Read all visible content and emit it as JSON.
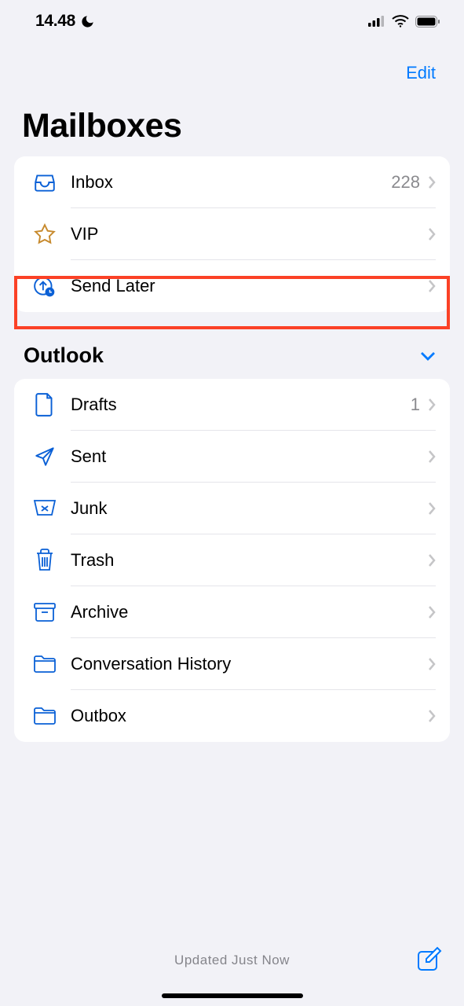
{
  "status_bar": {
    "time": "14.48"
  },
  "nav": {
    "edit": "Edit"
  },
  "title": "Mailboxes",
  "main_list": [
    {
      "label": "Inbox",
      "count": "228"
    },
    {
      "label": "VIP",
      "count": ""
    },
    {
      "label": "Send Later",
      "count": ""
    }
  ],
  "section": {
    "title": "Outlook"
  },
  "outlook_list": [
    {
      "label": "Drafts",
      "count": "1"
    },
    {
      "label": "Sent",
      "count": ""
    },
    {
      "label": "Junk",
      "count": ""
    },
    {
      "label": "Trash",
      "count": ""
    },
    {
      "label": "Archive",
      "count": ""
    },
    {
      "label": "Conversation History",
      "count": ""
    },
    {
      "label": "Outbox",
      "count": ""
    }
  ],
  "footer": {
    "status": "Updated Just Now"
  }
}
